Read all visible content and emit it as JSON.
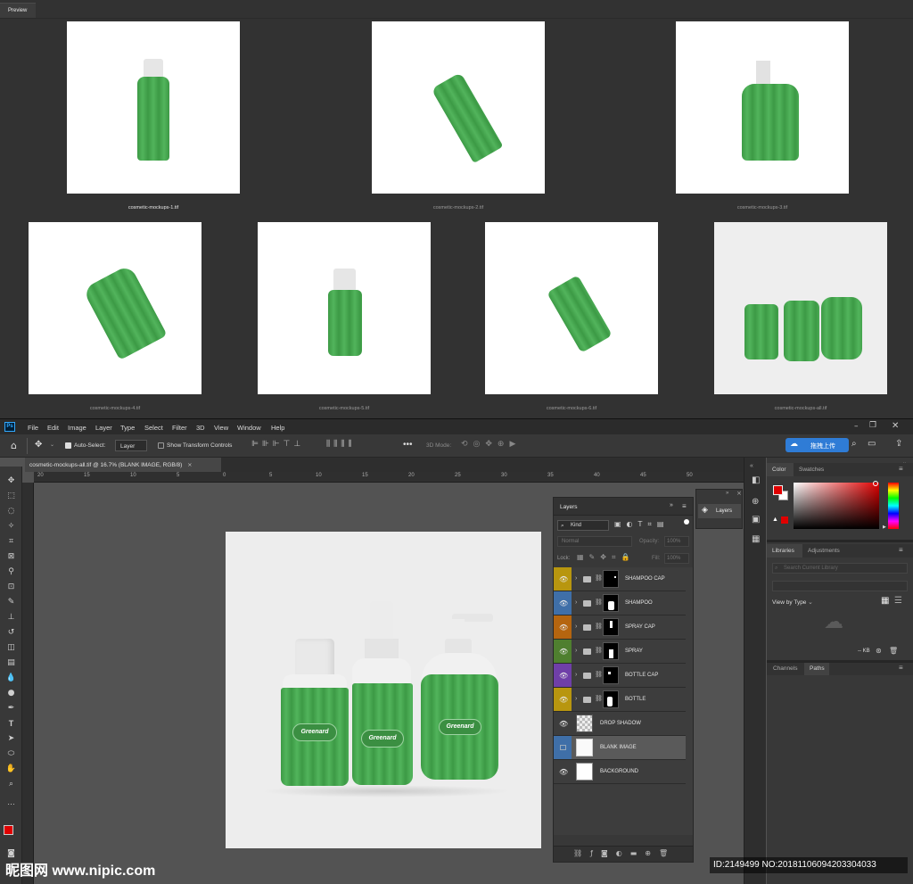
{
  "preview": {
    "tab_label": "Preview",
    "thumbnails": [
      {
        "caption": "cosmetic-mockups-1.tif"
      },
      {
        "caption": "cosmetic-mockups-2.tif"
      },
      {
        "caption": "cosmetic-mockups-3.tif"
      },
      {
        "caption": "cosmetic-mockups-4.tif"
      },
      {
        "caption": "cosmetic-mockups-5.tif"
      },
      {
        "caption": "cosmetic-mockups-6.tif"
      },
      {
        "caption": "cosmetic-mockups-all.tif"
      }
    ]
  },
  "menu": [
    "File",
    "Edit",
    "Image",
    "Layer",
    "Type",
    "Select",
    "Filter",
    "3D",
    "View",
    "Window",
    "Help"
  ],
  "app_logo": "Ps",
  "options": {
    "auto_select_label": "Auto-Select:",
    "auto_select_target": "Layer",
    "show_transform_label": "Show Transform Controls",
    "mode_3d_label": "3D Mode:",
    "upload_button": "拖拽上传"
  },
  "document": {
    "tab_title": "cosmetic-mockups-all.tif @ 16.7% (BLANK IMAGE, RGB/8)",
    "ruler_h_labels": [
      "20",
      "15",
      "10",
      "5",
      "0",
      "5",
      "10",
      "15",
      "20",
      "25",
      "30",
      "35",
      "40",
      "45",
      "50"
    ],
    "brand_label": "Greenard"
  },
  "layers_panel": {
    "title": "Layers",
    "filter_kind": "Kind",
    "blend_mode": "Normal",
    "opacity_label": "Opacity:",
    "opacity_value": "100%",
    "lock_label": "Lock:",
    "fill_label": "Fill:",
    "fill_value": "100%",
    "layers": [
      {
        "name": "SHAMPOO CAP",
        "color": "#b8960f",
        "group": true
      },
      {
        "name": "SHAMPOO",
        "color": "#3f6fa8",
        "group": true
      },
      {
        "name": "SPRAY CAP",
        "color": "#b5650f",
        "group": true
      },
      {
        "name": "SPRAY",
        "color": "#4f7f2f",
        "group": true
      },
      {
        "name": "BOTTLE CAP",
        "color": "#6f3fa8",
        "group": true
      },
      {
        "name": "BOTTLE",
        "color": "#b8960f",
        "group": true
      },
      {
        "name": "DROP SHADOW",
        "color": "#3d3d3d",
        "group": false
      },
      {
        "name": "BLANK IMAGE",
        "color": "#3f6fa8",
        "group": false,
        "selected": true
      },
      {
        "name": "BACKGROUND",
        "color": "#3d3d3d",
        "group": false
      }
    ]
  },
  "mini_panel": {
    "label": "Layers"
  },
  "right_panel": {
    "color_tab": "Color",
    "swatches_tab": "Swatches",
    "libraries_tab": "Libraries",
    "adjustments_tab": "Adjustments",
    "search_placeholder": "Search Current Library",
    "view_by_label": "View by Type",
    "kb_label": "-- KB",
    "channels_tab": "Channels",
    "paths_tab": "Paths"
  },
  "watermark": {
    "left": "昵图网 www.nipic.com",
    "right": "ID:2149499 NO:20181106094203304033"
  },
  "colors": {
    "foreground": "#e00000",
    "background": "#ffffff",
    "accent": "#2f7cd6",
    "bottle_green": "#47a64f"
  }
}
